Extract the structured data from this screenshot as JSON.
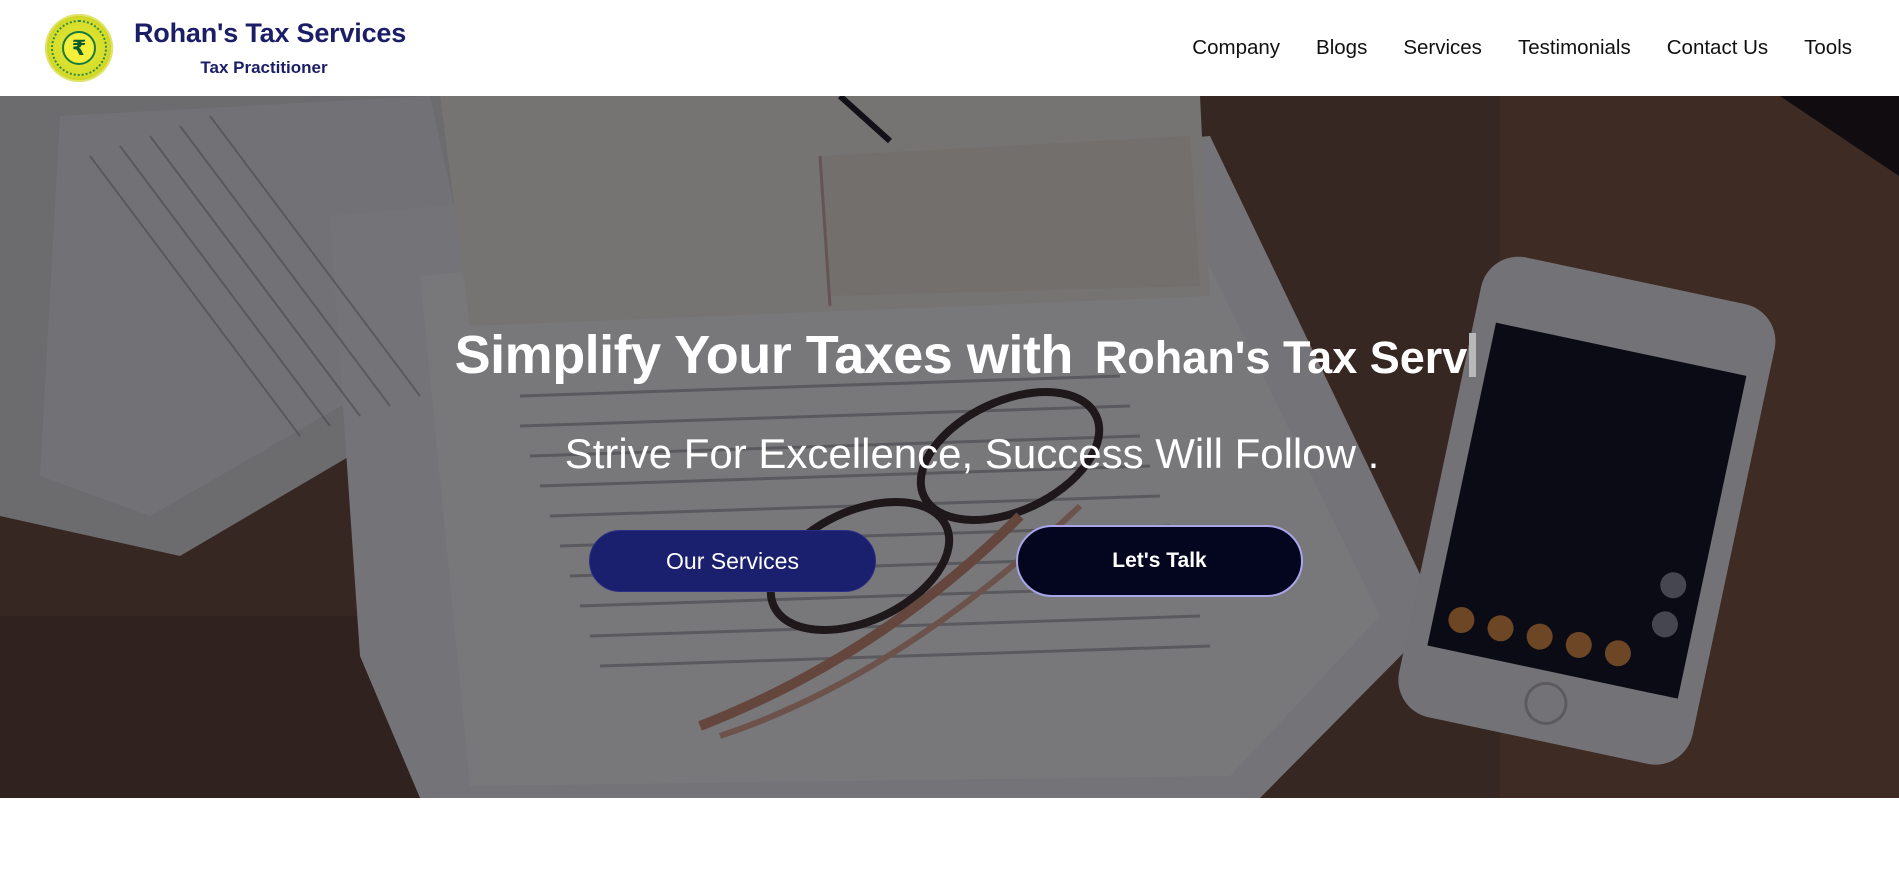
{
  "header": {
    "brand_name": "Rohan's Tax Services",
    "brand_subtitle": "Tax Practitioner",
    "logo_symbol": "₹",
    "logo_icon": "rupee-seal-icon"
  },
  "nav": {
    "items": [
      {
        "label": "Company"
      },
      {
        "label": "Blogs"
      },
      {
        "label": "Services"
      },
      {
        "label": "Testimonials"
      },
      {
        "label": "Contact Us"
      },
      {
        "label": "Tools"
      }
    ]
  },
  "hero": {
    "title_lead": "Simplify Your Taxes with",
    "title_typed": "Rohan's Tax Serv",
    "tagline": "Strive For Excellence, Success Will Follow .",
    "primary_button": "Our Services",
    "secondary_button": "Let's Talk"
  },
  "colors": {
    "brand_navy": "#1b1d66",
    "primary_button_bg": "#1a1f6e",
    "secondary_button_bg": "#04061f",
    "secondary_button_border": "#a9a6e8",
    "logo_yellow": "#e6ea3a",
    "logo_green": "#1a7a3a"
  }
}
